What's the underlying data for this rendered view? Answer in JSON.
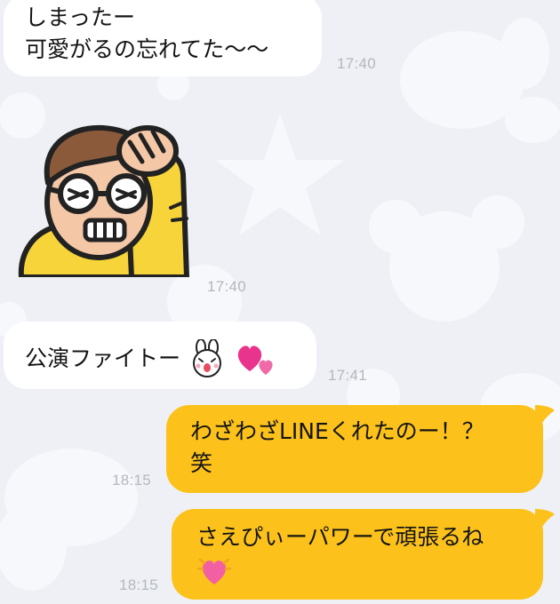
{
  "messages": [
    {
      "side": "incoming",
      "lines": [
        "しまったー",
        "可愛がるの忘れてた〜〜"
      ],
      "time": "17:40"
    },
    {
      "side": "incoming",
      "sticker": "frustrated-man-with-glasses-sticker",
      "time": "17:40"
    },
    {
      "side": "incoming",
      "lines": [
        "公演ファイトー"
      ],
      "emojis": [
        "bunny-face-emoji",
        "hearts-emoji"
      ],
      "time": "17:41"
    },
    {
      "side": "outgoing",
      "lines": [
        "わざわざLINEくれたのー！？",
        "笑"
      ],
      "time": "18:15"
    },
    {
      "side": "outgoing",
      "lines": [
        "さえぴぃーパワーで頑張るね"
      ],
      "emojis": [
        "glowing-heart-emoji"
      ],
      "time": "18:15"
    }
  ],
  "colors": {
    "background": "#eef0f5",
    "incoming_bubble": "#ffffff",
    "outgoing_bubble": "#fcc21b",
    "timestamp": "#b3b7bf"
  }
}
